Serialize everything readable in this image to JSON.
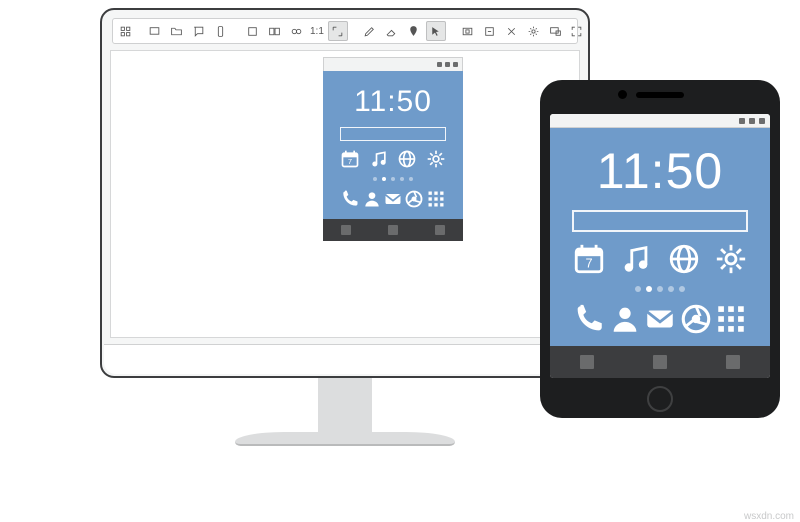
{
  "toolbar": {
    "ratio_label": "1:1"
  },
  "emulator": {
    "clock": "11:50",
    "pager": {
      "count": 5,
      "active": 1
    },
    "search_placeholder": ""
  },
  "physical_phone": {
    "clock": "11:50",
    "pager": {
      "count": 5,
      "active": 1
    },
    "search_placeholder": ""
  },
  "home_icons_row1": [
    "calendar",
    "music",
    "globe",
    "settings"
  ],
  "home_icons_row2": [
    "phone",
    "contacts",
    "mail",
    "browser",
    "apps-grid"
  ],
  "calendar_day": "7",
  "watermark": "wsxdn.com"
}
